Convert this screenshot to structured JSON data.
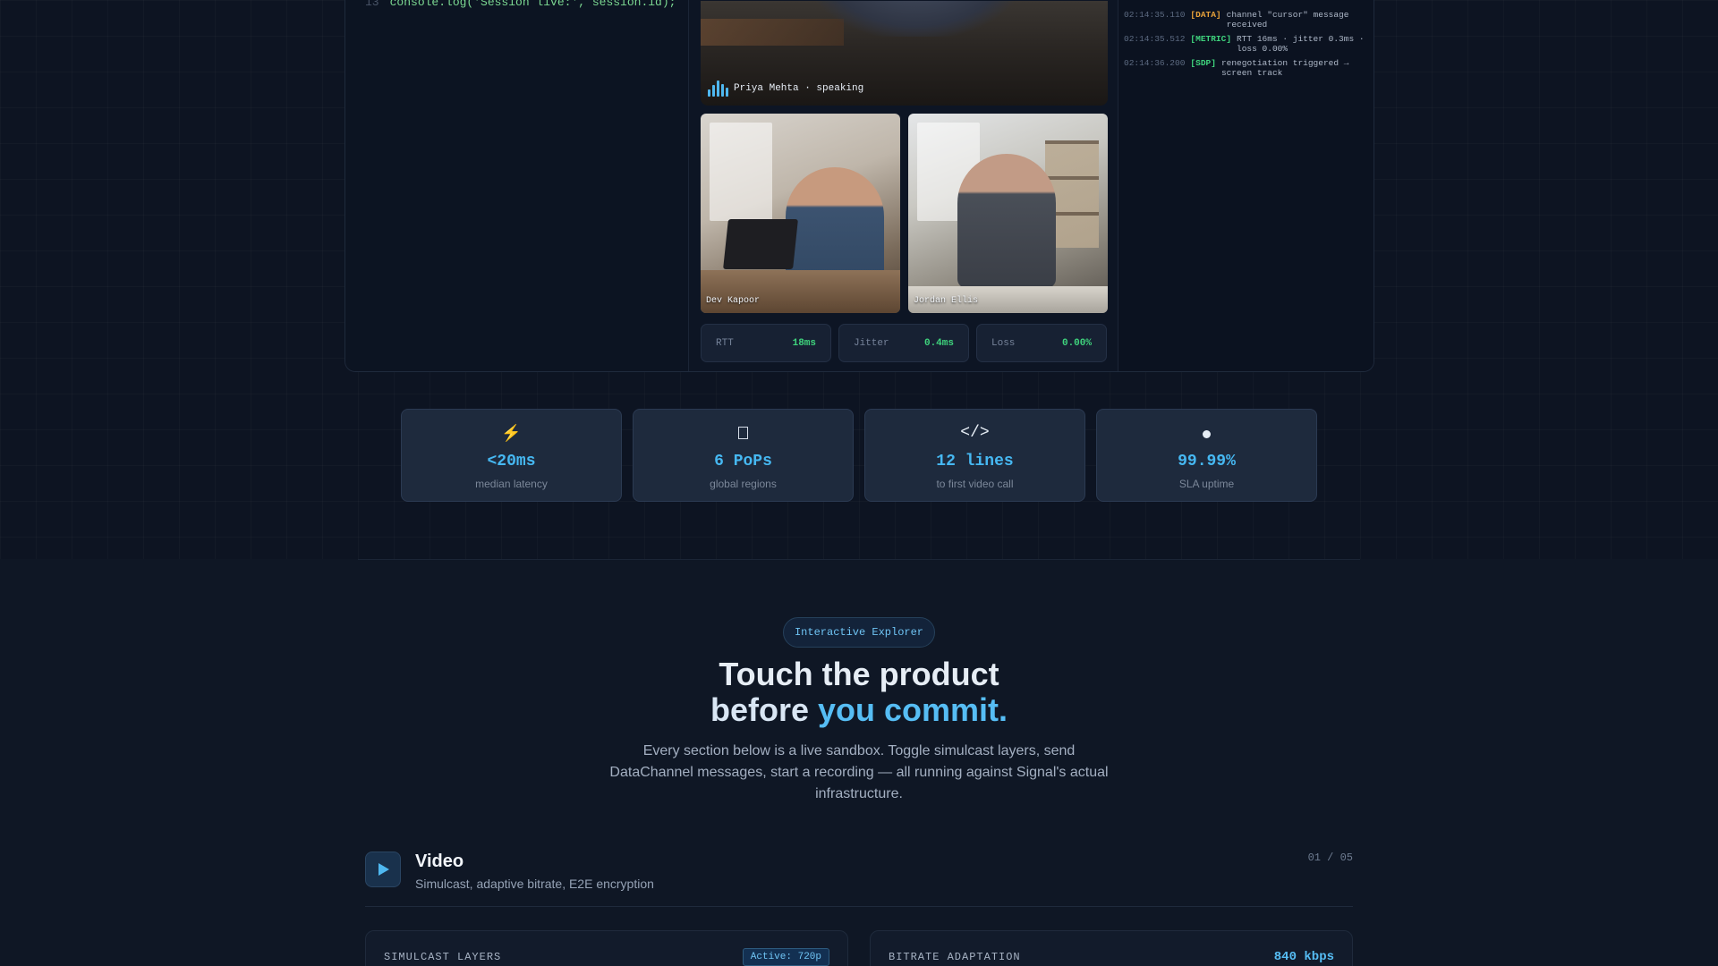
{
  "demo": {
    "code": {
      "line_number": "13",
      "text": "console.log('Session live:', session.id);"
    },
    "main_speaker": {
      "label": "Priya Mehta · speaking"
    },
    "participants": [
      {
        "name": "Dev Kapoor"
      },
      {
        "name": "Jordan Ellis"
      }
    ],
    "metrics": [
      {
        "label": "RTT",
        "value": "18ms"
      },
      {
        "label": "Jitter",
        "value": "0.4ms"
      },
      {
        "label": "Loss",
        "value": "0.00%"
      }
    ],
    "log": [
      {
        "time": "02:14:35.110",
        "tag": "[DATA]",
        "tag_color": "#e8a23a",
        "message": "channel \"cursor\" message received"
      },
      {
        "time": "02:14:35.512",
        "tag": "[METRIC]",
        "tag_color": "#3fd47d",
        "message": "RTT 16ms · jitter 0.3ms · loss 0.00%"
      },
      {
        "time": "02:14:36.200",
        "tag": "[SDP]",
        "tag_color": "#3fd47d",
        "message": "renegotiation triggered → screen track"
      }
    ]
  },
  "stats": [
    {
      "icon": "lightning-icon",
      "glyph": "⚡",
      "value": "<20ms",
      "label": "median latency"
    },
    {
      "icon": "globe-icon",
      "glyph": "",
      "value": "6 PoPs",
      "label": "global regions"
    },
    {
      "icon": "code-icon",
      "glyph": "</>",
      "value": "12 lines",
      "label": "to first video call"
    },
    {
      "icon": "uptime-dot-icon",
      "glyph": "",
      "value": "99.99%",
      "label": "SLA uptime"
    }
  ],
  "explorer": {
    "pill": "Interactive Explorer",
    "heading_line1": "Touch the product",
    "heading_line2_plain": "before ",
    "heading_line2_accent": "you commit.",
    "lead": "Every section below is a live sandbox. Toggle simulcast layers, send DataChannel messages, start a recording — all running against Signal's actual infrastructure."
  },
  "feature": {
    "title": "Video",
    "subtitle": "Simulcast, adaptive bitrate, E2E encryption",
    "counter": "01 / 05"
  },
  "cards": {
    "simulcast": {
      "title": "SIMULCAST LAYERS",
      "badge": "Active: 720p"
    },
    "bitrate": {
      "title": "BITRATE ADAPTATION",
      "value": "840 kbps"
    }
  },
  "colors": {
    "accent": "#56bdf4",
    "success": "#3fd47d",
    "warning": "#e8a23a"
  }
}
